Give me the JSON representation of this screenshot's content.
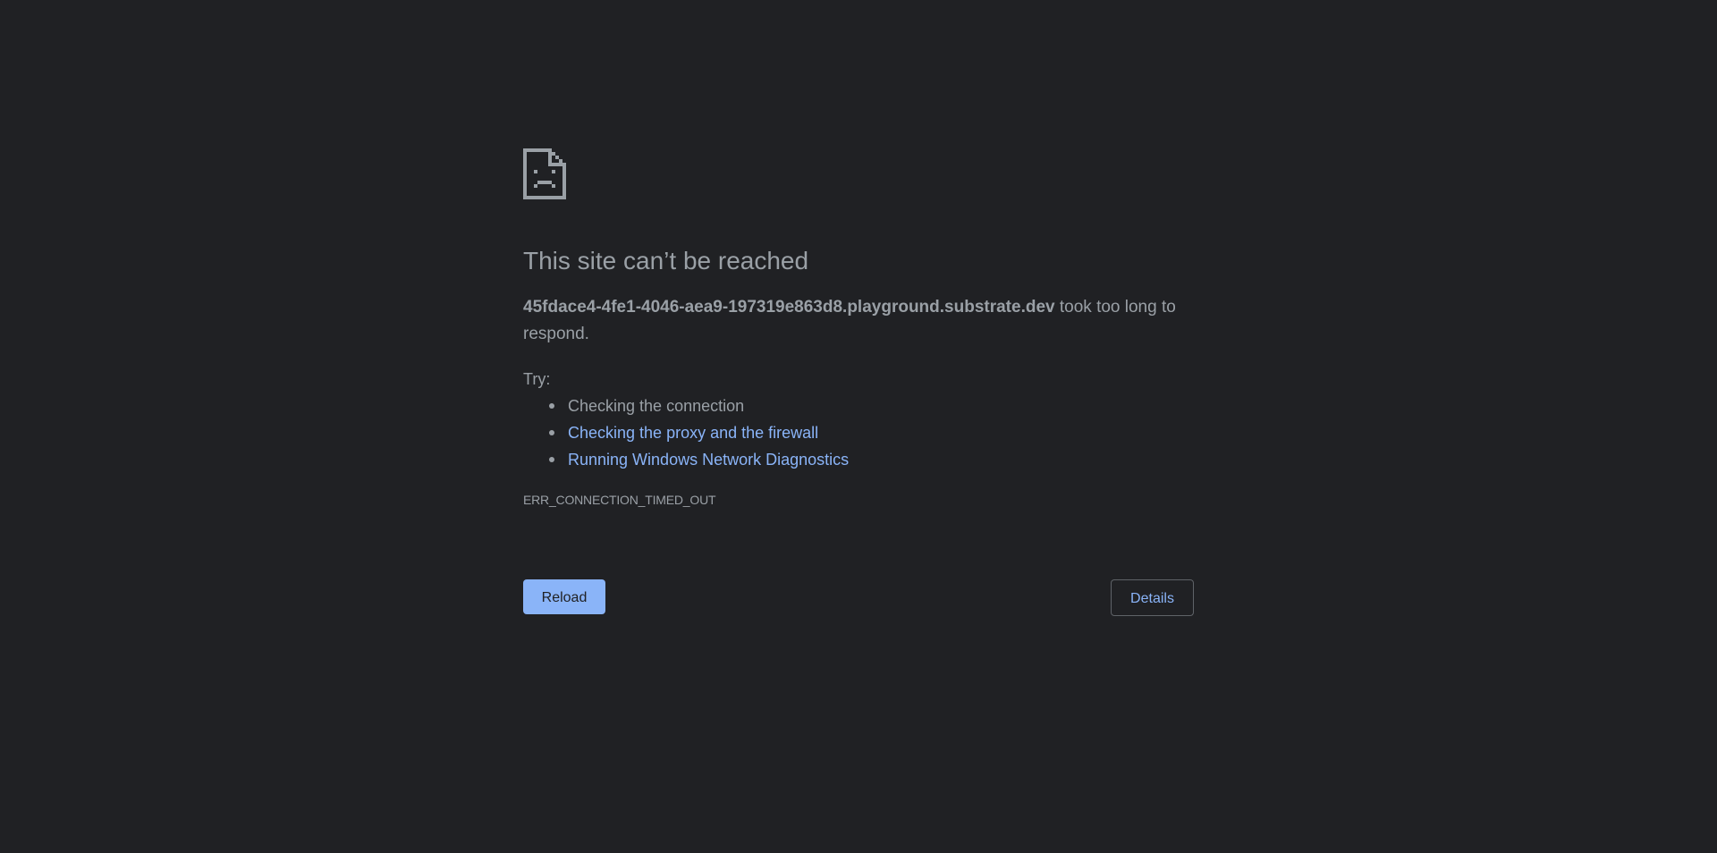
{
  "error_page": {
    "icon": "sad-document-icon",
    "heading": "This site can’t be reached",
    "host": "45fdace4-4fe1-4046-aea9-197319e863d8.playground.substrate.dev",
    "summary_suffix": " took too long to respond.",
    "try_label": "Try:",
    "suggestions": [
      {
        "label": "Checking the connection",
        "link": false
      },
      {
        "label": "Checking the proxy and the firewall",
        "link": true
      },
      {
        "label": "Running Windows Network Diagnostics",
        "link": true
      }
    ],
    "error_code": "ERR_CONNECTION_TIMED_OUT"
  },
  "buttons": {
    "reload_label": "Reload",
    "details_label": "Details"
  },
  "colors": {
    "background": "#202124",
    "text": "#9aa0a6",
    "link": "#8ab4f8",
    "button_primary_bg": "#8ab4f8",
    "button_border": "#5f6368"
  }
}
